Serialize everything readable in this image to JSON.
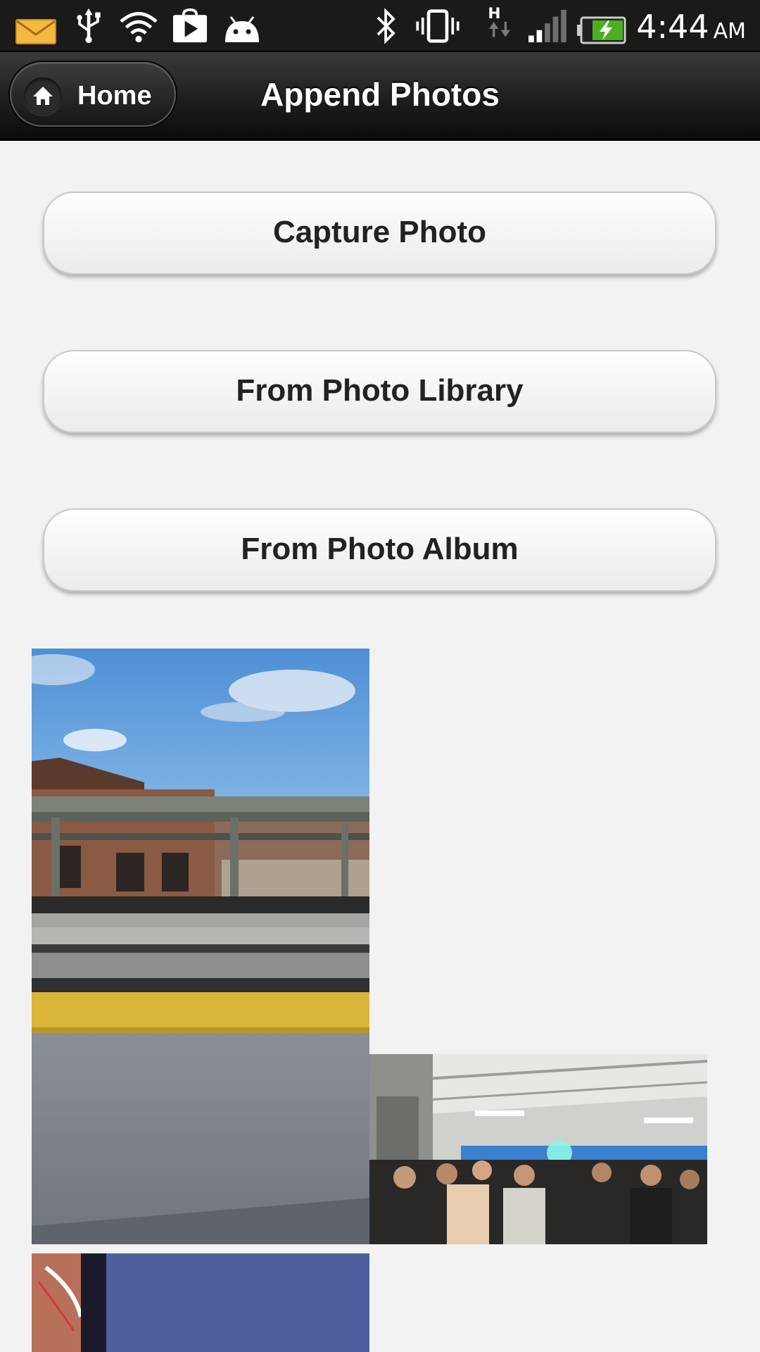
{
  "status_bar": {
    "time": "4:44",
    "ampm": "AM",
    "icons": [
      "mail-icon",
      "usb-icon",
      "wifi-icon",
      "play-store-icon",
      "android-icon",
      "bluetooth-icon",
      "vibrate-icon",
      "data-h-icon",
      "signal-icon",
      "battery-charging-icon"
    ]
  },
  "header": {
    "home_label": "Home",
    "title": "Append Photos"
  },
  "actions": {
    "capture": "Capture Photo",
    "library": "From Photo Library",
    "album": "From Photo Album"
  },
  "colors": {
    "header": "#1e1e1e",
    "background": "#f2f2f2",
    "button_text": "#222222"
  }
}
